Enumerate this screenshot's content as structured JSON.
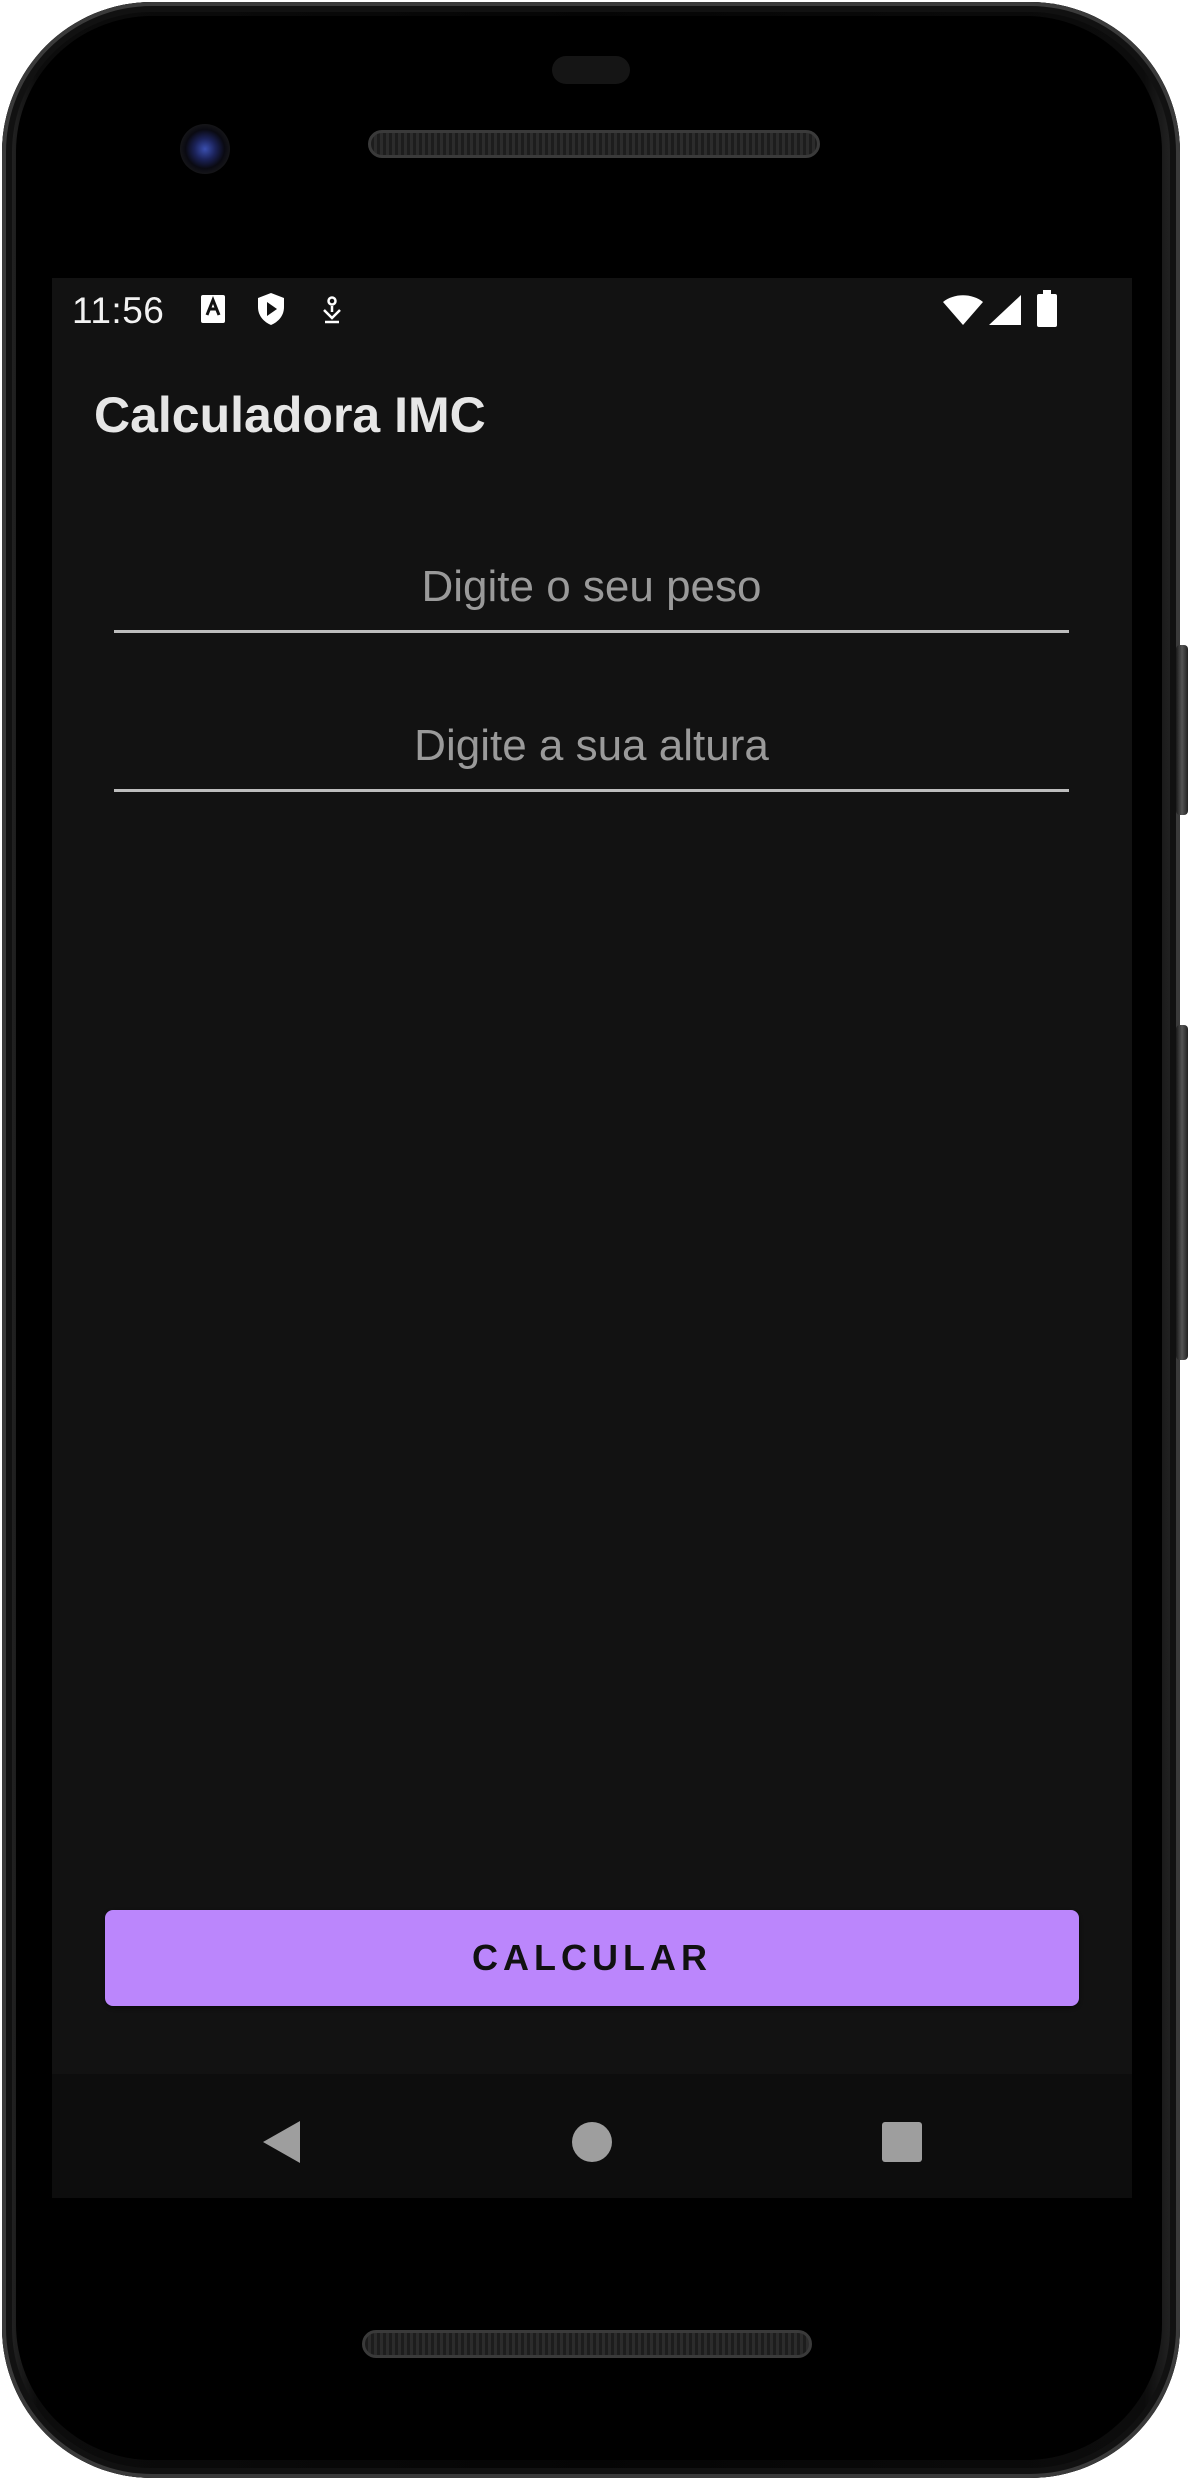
{
  "status_bar": {
    "time": "11:56",
    "left_icons": [
      "font-a-icon",
      "play-protect-icon",
      "debug-icon"
    ],
    "right_icons": [
      "wifi-icon",
      "signal-icon",
      "battery-icon"
    ]
  },
  "app_bar": {
    "title": "Calculadora IMC"
  },
  "form": {
    "peso_placeholder": "Digite o seu peso",
    "peso_value": "",
    "altura_placeholder": "Digite a sua altura",
    "altura_value": ""
  },
  "actions": {
    "calculate_label": "CALCULAR"
  },
  "nav_bar": {
    "buttons": [
      "back-icon",
      "home-icon",
      "recents-icon"
    ]
  },
  "colors": {
    "background": "#121212",
    "accent": "#bb86fc",
    "title_text": "#e6e6e6",
    "hint_text": "#9a9a9a"
  }
}
